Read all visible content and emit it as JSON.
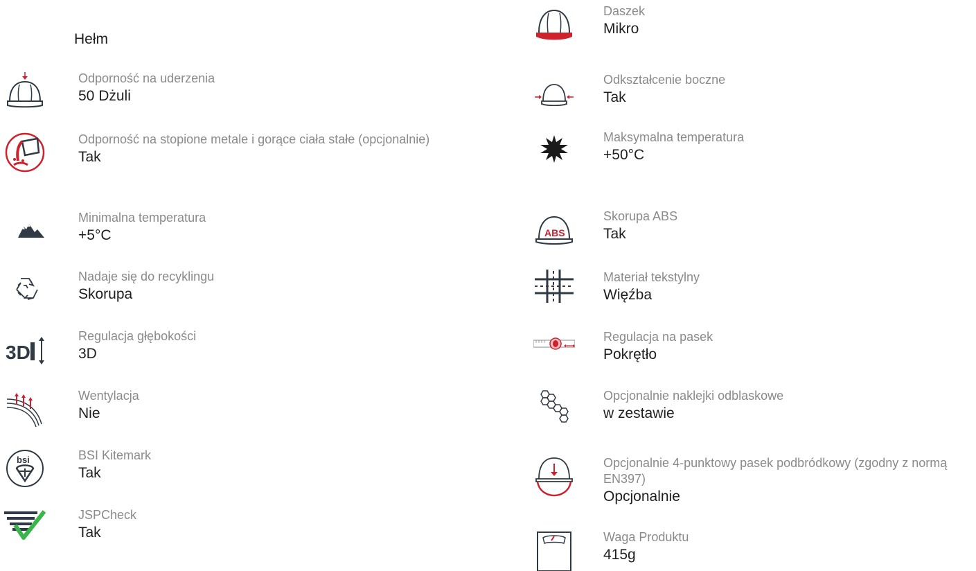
{
  "title": "Hełm",
  "left": [
    {
      "label": "Odporność na uderzenia",
      "value": "50 Dżuli",
      "icon": "helmet-impact-icon"
    },
    {
      "label": "Odporność na stopione metale i gorące ciała stałe (opcjonalnie)",
      "value": "Tak",
      "icon": "molten-metal-icon"
    },
    {
      "label": "Minimalna temperatura",
      "value": "+5°C",
      "icon": "mountains-icon"
    },
    {
      "label": "Nadaje się do recyklingu",
      "value": "Skorupa",
      "icon": "recycle-icon"
    },
    {
      "label": "Regulacja głębokości",
      "value": "3D",
      "icon": "3d-depth-icon"
    },
    {
      "label": "Wentylacja",
      "value": "Nie",
      "icon": "ventilation-icon"
    },
    {
      "label": "BSI Kitemark",
      "value": "Tak",
      "icon": "bsi-kitemark-icon"
    },
    {
      "label": "JSPCheck",
      "value": "Tak",
      "icon": "jspcheck-icon"
    }
  ],
  "right": [
    {
      "label": "Daszek",
      "value": "Mikro",
      "icon": "helmet-peak-icon"
    },
    {
      "label": "Odkształcenie boczne",
      "value": "Tak",
      "icon": "lateral-deformation-icon"
    },
    {
      "label": "Maksymalna temperatura",
      "value": "+50°C",
      "icon": "sun-icon"
    },
    {
      "label": "Skorupa ABS",
      "value": "Tak",
      "icon": "abs-shell-icon",
      "icon_text": "ABS"
    },
    {
      "label": "Materiał tekstylny",
      "value": "Więźba",
      "icon": "textile-icon"
    },
    {
      "label": "Regulacja na pasek",
      "value": "Pokrętło",
      "icon": "wheel-ratchet-icon"
    },
    {
      "label": "Opcjonalnie naklejki odblaskowe",
      "value": "w zestawie",
      "icon": "hexagons-icon"
    },
    {
      "label": "Opcjonalnie 4-punktowy pasek podbródkowy (zgodny z normą EN397)",
      "value": "Opcjonalnie",
      "icon": "chin-strap-icon"
    },
    {
      "label": "Waga Produktu",
      "value": "415g",
      "icon": "scale-icon"
    }
  ],
  "colors": {
    "accent": "#d0202c",
    "dark": "#2f3a45",
    "check": "#3ab54a",
    "label": "#8a8a8a",
    "value": "#1f1f1f"
  }
}
